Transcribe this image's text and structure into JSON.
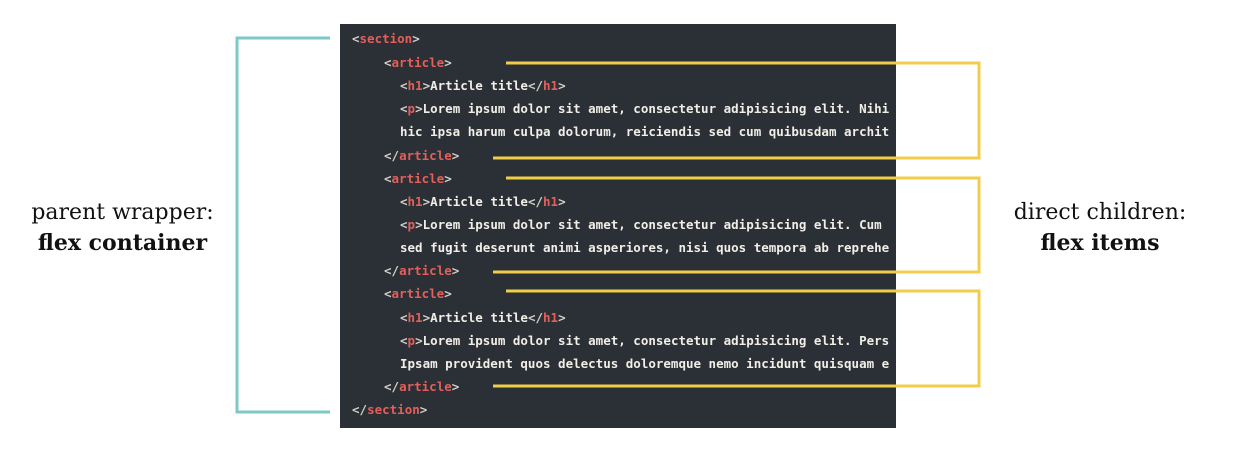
{
  "labels": {
    "left_line1": "parent wrapper:",
    "left_line2": "flex container",
    "right_line1": "direct children:",
    "right_line2": "flex items"
  },
  "colors": {
    "editor_bg": "#2b2f36",
    "tag": "#e55f5a",
    "text": "#f0eee6",
    "container_bracket": "#7ec8c8",
    "item_bracket": "#f2cd4a"
  },
  "code": {
    "line1": {
      "open": "<",
      "tag": "section",
      "close": ">"
    },
    "line2": {
      "open": "<",
      "tag": "article",
      "close": ">"
    },
    "line3": {
      "open": "<",
      "tag": "h1",
      "close": ">",
      "text": "Article title",
      "end_open": "</",
      "end_tag": "h1",
      "end_close": ">"
    },
    "line4": {
      "open": "<",
      "tag": "p",
      "close": ">",
      "text": "Lorem ipsum dolor sit amet, consectetur adipisicing elit. Nihi"
    },
    "line5": {
      "text": "hic ipsa harum culpa dolorum, reiciendis sed cum quibusdam archit"
    },
    "line6": {
      "open": "</",
      "tag": "article",
      "close": ">"
    },
    "line7": {
      "open": "<",
      "tag": "article",
      "close": ">"
    },
    "line8": {
      "open": "<",
      "tag": "h1",
      "close": ">",
      "text": "Article title",
      "end_open": "</",
      "end_tag": "h1",
      "end_close": ">"
    },
    "line9": {
      "open": "<",
      "tag": "p",
      "close": ">",
      "text": "Lorem ipsum dolor sit amet, consectetur adipisicing elit. Cum"
    },
    "line10": {
      "text": "sed fugit deserunt animi asperiores, nisi quos tempora ab reprehe"
    },
    "line11": {
      "open": "</",
      "tag": "article",
      "close": ">"
    },
    "line12": {
      "open": "<",
      "tag": "article",
      "close": ">"
    },
    "line13": {
      "open": "<",
      "tag": "h1",
      "close": ">",
      "text": "Article title",
      "end_open": "</",
      "end_tag": "h1",
      "end_close": ">"
    },
    "line14": {
      "open": "<",
      "tag": "p",
      "close": ">",
      "text": "Lorem ipsum dolor sit amet, consectetur adipisicing elit. Pers"
    },
    "line15": {
      "text": "Ipsam provident quos delectus doloremque nemo incidunt quisquam e"
    },
    "line16": {
      "open": "</",
      "tag": "article",
      "close": ">"
    },
    "line17": {
      "open": "</",
      "tag": "section",
      "close": ">"
    }
  }
}
